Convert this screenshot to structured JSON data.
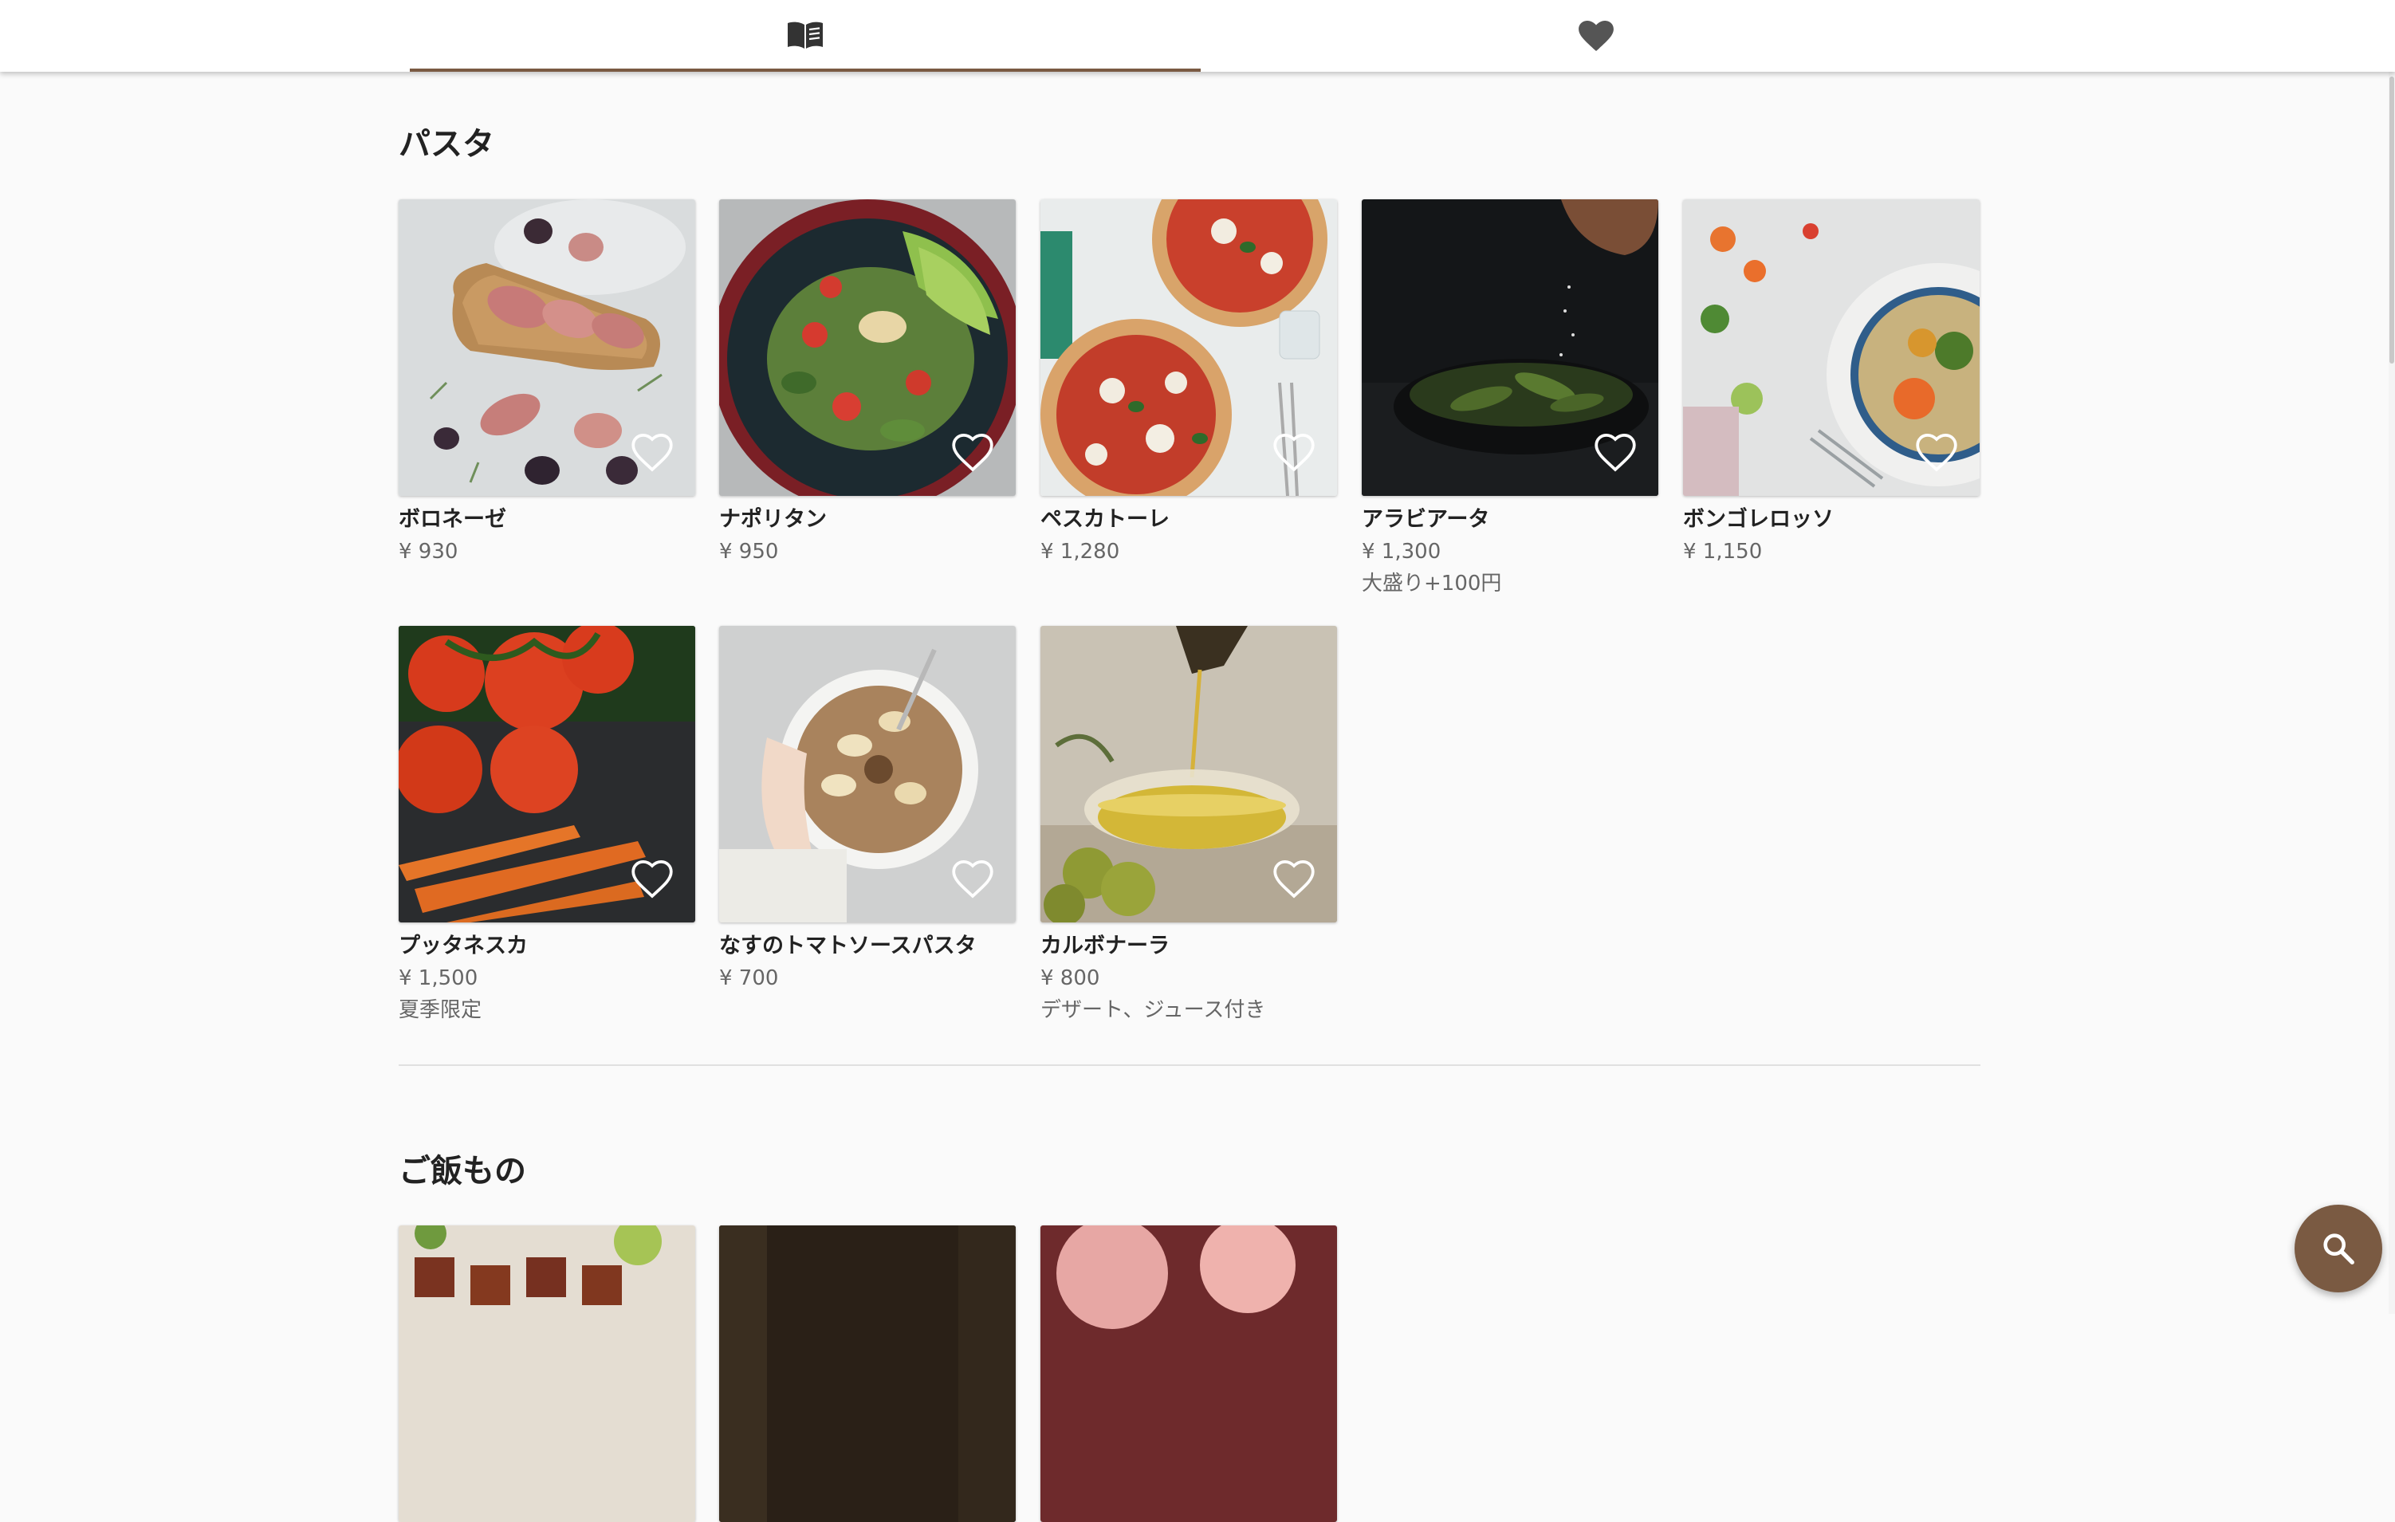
{
  "tabs": [
    {
      "label": "",
      "icon": "menu-book-icon",
      "selected": true
    },
    {
      "label": "",
      "icon": "heart-icon",
      "selected": false
    }
  ],
  "sections": [
    {
      "title": "パスタ",
      "items": [
        {
          "name": "ボロネーゼ",
          "price": "¥ 930",
          "note": "",
          "photo": "bacon-wrapped-plums-photo"
        },
        {
          "name": "ナポリタン",
          "price": "¥ 950",
          "note": "",
          "photo": "salad-bowl-photo"
        },
        {
          "name": "ペスカトーレ",
          "price": "¥ 1,280",
          "note": "",
          "photo": "pizza-photo"
        },
        {
          "name": "アラビアータ",
          "price": "¥ 1,300",
          "note": "大盛り+100円",
          "photo": "edamame-salt-photo"
        },
        {
          "name": "ボンゴレロッソ",
          "price": "¥ 1,150",
          "note": "",
          "photo": "vegetable-bowl-photo"
        },
        {
          "name": "プッタネスカ",
          "price": "¥ 1,500",
          "note": "夏季限定",
          "photo": "tomatoes-carrots-photo"
        },
        {
          "name": "なすのトマトソースパスタ",
          "price": "¥ 700",
          "note": "",
          "photo": "granola-bowl-photo"
        },
        {
          "name": "カルボナーラ",
          "price": "¥ 800",
          "note": "デザート、ジュース付き",
          "photo": "olive-oil-photo"
        }
      ]
    },
    {
      "title": "ご飯もの",
      "items": [
        {
          "name": "",
          "price": "",
          "note": "",
          "photo": "grilled-meat-photo"
        },
        {
          "name": "",
          "price": "",
          "note": "",
          "photo": "dark-dish-photo"
        },
        {
          "name": "",
          "price": "",
          "note": "",
          "photo": "pink-dessert-photo"
        }
      ]
    }
  ],
  "fab": {
    "icon": "search-icon"
  },
  "colors": {
    "accent": "#7a5a42",
    "background": "#fafafa",
    "text": "#222222",
    "subtext": "#666666"
  }
}
